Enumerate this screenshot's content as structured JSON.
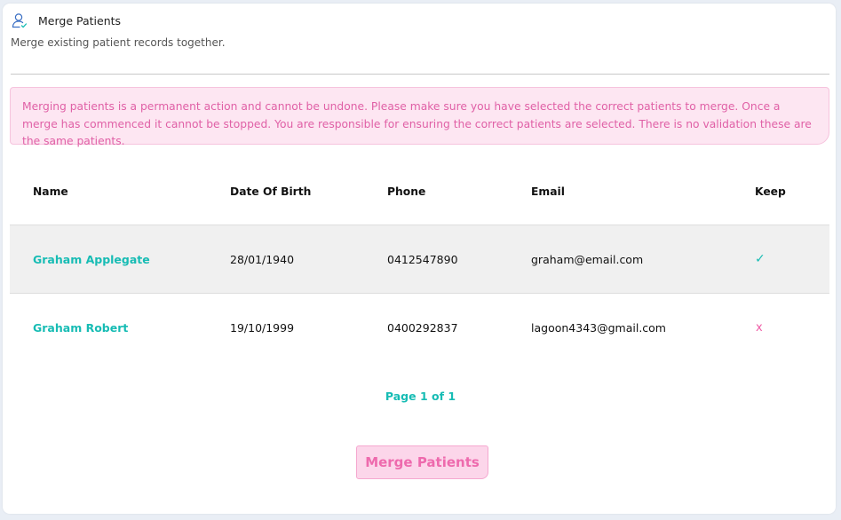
{
  "header": {
    "icon": "user-icon",
    "title": "Merge Patients",
    "subtitle": "Merge existing patient records together."
  },
  "warning": {
    "text": "Merging patients is a permanent action and cannot be undone. Please make sure you have selected the correct patients to merge. Once a merge has commenced it cannot be stopped. You are responsible for ensuring the correct patients are selected. There is no validation these are the same patients."
  },
  "table": {
    "columns": [
      "Name",
      "Date Of Birth",
      "Phone",
      "Email",
      "Keep"
    ],
    "rows": [
      {
        "name": "Graham Applegate",
        "dob": "28/01/1940",
        "phone": "0412547890",
        "email": "graham@email.com",
        "keep": "✓"
      },
      {
        "name": "Graham Robert",
        "dob": "19/10/1999",
        "phone": "0400292837",
        "email": "lagoon4343@gmail.com",
        "keep": "x"
      }
    ]
  },
  "pagination": {
    "label": "Page 1 of 1"
  },
  "actions": {
    "merge_label": "Merge Patients"
  },
  "colors": {
    "accent": "#17bcb4",
    "warning_text": "#e060a6",
    "warning_bg": "#fde6f2",
    "button_bg": "#fcd6ea",
    "button_text": "#ee6aad"
  }
}
